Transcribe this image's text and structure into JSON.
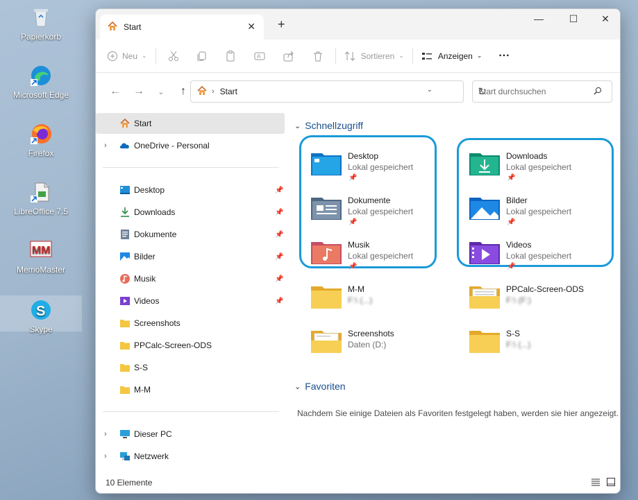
{
  "desktop": {
    "icons": [
      {
        "label": "Papierkorb",
        "icon": "recycle-bin-icon"
      },
      {
        "label": "Microsoft Edge",
        "icon": "edge-icon"
      },
      {
        "label": "Firefox",
        "icon": "firefox-icon"
      },
      {
        "label": "LibreOffice 7.5",
        "icon": "libreoffice-icon"
      },
      {
        "label": "MemoMaster",
        "icon": "memomaster-icon"
      },
      {
        "label": "Skype",
        "icon": "skype-icon"
      }
    ]
  },
  "window": {
    "tab_title": "Start",
    "tab_close": "✕",
    "new_tab": "+",
    "controls": {
      "minimize": "—",
      "maximize": "☐",
      "close": "✕"
    }
  },
  "toolbar": {
    "new_label": "Neu",
    "sort_label": "Sortieren",
    "view_label": "Anzeigen",
    "more_label": "···"
  },
  "nav": {
    "address_text": "Start",
    "search_placeholder": "Start durchsuchen"
  },
  "sidebar": {
    "home": "Start",
    "onedrive": "OneDrive - Personal",
    "pinned": [
      {
        "label": "Desktop",
        "icon": "desktop-folder-icon"
      },
      {
        "label": "Downloads",
        "icon": "download-icon"
      },
      {
        "label": "Dokumente",
        "icon": "documents-icon"
      },
      {
        "label": "Bilder",
        "icon": "pictures-icon"
      },
      {
        "label": "Musik",
        "icon": "music-icon"
      },
      {
        "label": "Videos",
        "icon": "videos-icon"
      }
    ],
    "folders": [
      "Screenshots",
      "PPCalc-Screen-ODS",
      "S-S",
      "M-M"
    ],
    "this_pc": "Dieser PC",
    "network": "Netzwerk"
  },
  "main": {
    "quick_access_title": "Schnellzugriff",
    "quick_access": [
      {
        "name": "Desktop",
        "sub": "Lokal gespeichert"
      },
      {
        "name": "Downloads",
        "sub": "Lokal gespeichert"
      },
      {
        "name": "Dokumente",
        "sub": "Lokal gespeichert"
      },
      {
        "name": "Bilder",
        "sub": "Lokal gespeichert"
      },
      {
        "name": "Musik",
        "sub": "Lokal gespeichert"
      },
      {
        "name": "Videos",
        "sub": "Lokal gespeichert"
      },
      {
        "name": "M-M",
        "sub": "F:\\ (...)"
      },
      {
        "name": "PPCalc-Screen-ODS",
        "sub": "F:\\ (F:)"
      },
      {
        "name": "Screenshots",
        "sub": "Daten (D:)"
      },
      {
        "name": "S-S",
        "sub": "F:\\ (...)"
      }
    ],
    "favorites_title": "Favoriten",
    "favorites_empty": "Nachdem Sie einige Dateien als Favoriten festgelegt haben, werden sie hier angezeigt."
  },
  "status": {
    "count": "10 Elemente"
  },
  "colors": {
    "accent": "#1a9ad9",
    "section_title": "#1a4f8c",
    "folder_yellow": "#f5c640"
  }
}
